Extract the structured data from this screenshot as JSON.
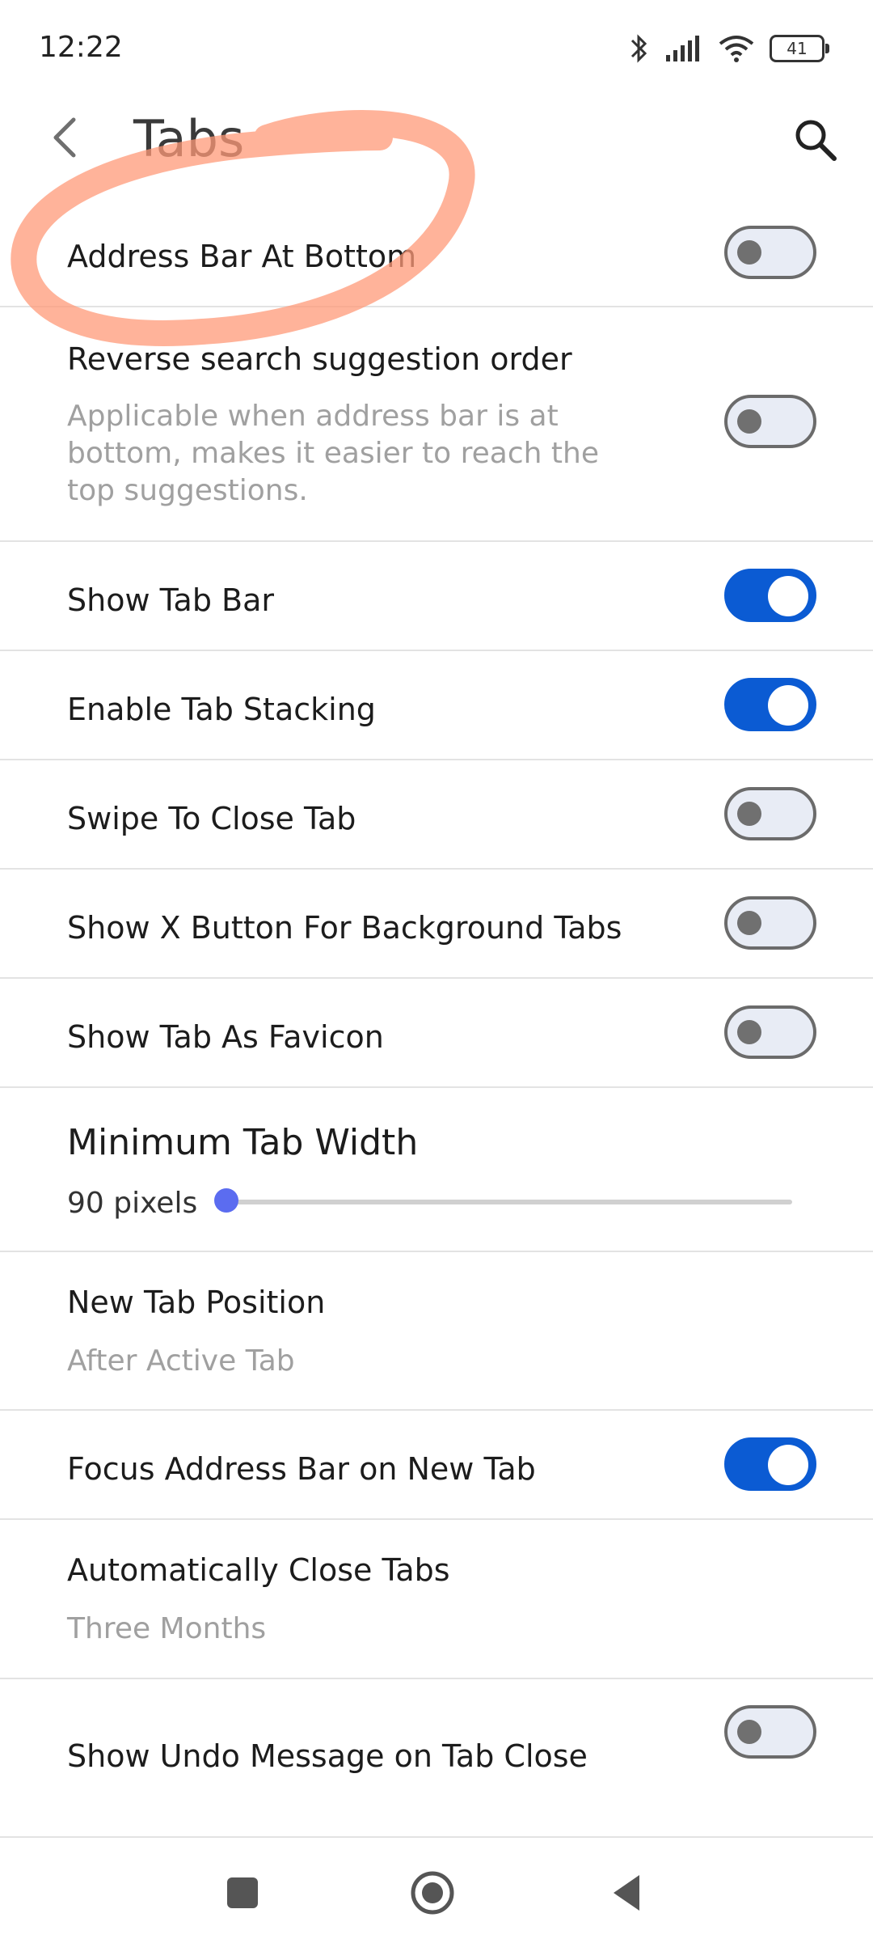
{
  "status_bar": {
    "time": "12:22",
    "battery": "41"
  },
  "app_bar": {
    "title": "Tabs"
  },
  "settings": {
    "address_bar_bottom": {
      "label": "Address Bar At Bottom",
      "enabled": false
    },
    "reverse_suggestion": {
      "label": "Reverse search suggestion order",
      "description": "Applicable when address bar is at bottom, makes it easier to reach the top suggestions.",
      "enabled": false
    },
    "show_tab_bar": {
      "label": "Show Tab Bar",
      "enabled": true
    },
    "tab_stacking": {
      "label": "Enable Tab Stacking",
      "enabled": true
    },
    "swipe_close": {
      "label": "Swipe To Close Tab",
      "enabled": false
    },
    "x_button": {
      "label": "Show X Button For Background Tabs",
      "enabled": false
    },
    "tab_favicon": {
      "label": "Show Tab As Favicon",
      "enabled": false
    },
    "min_tab_width": {
      "label": "Minimum Tab Width",
      "value": "90 pixels"
    },
    "new_tab_position": {
      "label": "New Tab Position",
      "value": "After Active Tab"
    },
    "focus_address_bar": {
      "label": "Focus Address Bar on New Tab",
      "enabled": true
    },
    "auto_close_tabs": {
      "label": "Automatically Close Tabs",
      "value": "Three Months"
    },
    "undo_message": {
      "label": "Show Undo Message on Tab Close",
      "enabled": false
    }
  },
  "colors": {
    "accent": "#0b5bd3",
    "slider_thumb": "#5b6cf0",
    "annotation_stroke": "#ff9a78"
  },
  "icons": {
    "back": "chevron-left-icon",
    "search": "search-icon",
    "nav_recents": "square-icon",
    "nav_home": "circle-icon",
    "nav_back": "triangle-back-icon"
  }
}
